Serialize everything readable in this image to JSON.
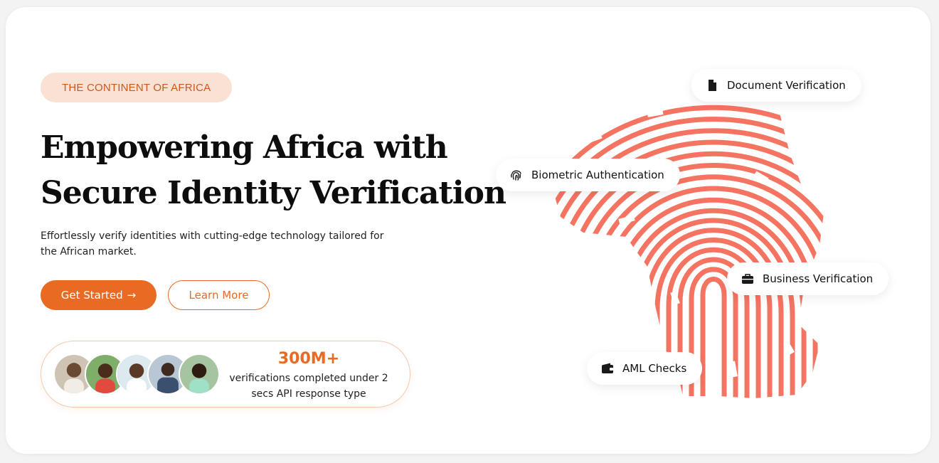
{
  "hero": {
    "badge": "THE CONTINENT OF AFRICA",
    "headline_line1": "Empowering Africa with",
    "headline_line2": "Secure Identity Verification",
    "subtitle": "Effortlessly verify identities with cutting-edge technology tailored for the African market.",
    "primary_button": "Get Started",
    "primary_button_arrow": "→",
    "secondary_button": "Learn More"
  },
  "stats": {
    "number": "300M+",
    "description": "verifications completed under 2 secs API response type"
  },
  "features": {
    "document": "Document Verification",
    "biometric": "Biometric Authentication",
    "business": "Business Verification",
    "aml": "AML Checks"
  },
  "colors": {
    "accent": "#e96a23",
    "fingerprint": "#f57461",
    "badge_bg": "#fbe1d3"
  },
  "icons": {
    "document": "document-icon",
    "biometric": "fingerprint-icon",
    "business": "briefcase-icon",
    "aml": "wallet-icon"
  }
}
